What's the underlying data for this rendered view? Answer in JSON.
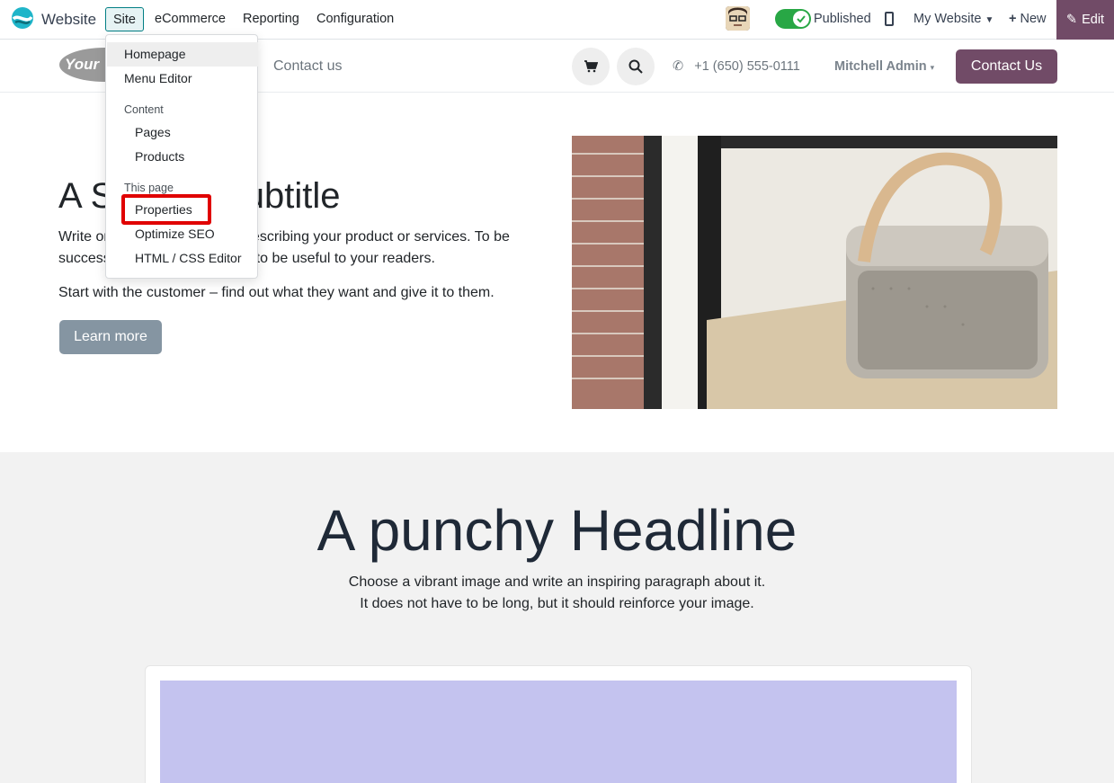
{
  "topbar": {
    "app_name": "Website",
    "menu": [
      "Site",
      "eCommerce",
      "Reporting",
      "Configuration"
    ],
    "published_label": "Published",
    "my_website": "My Website",
    "new_label": "New",
    "edit_label": "Edit"
  },
  "site_header": {
    "logo_text": "Your",
    "nav_contact": "Contact us",
    "phone": "+1 (650) 555-0111",
    "user": "Mitchell Admin",
    "contact_button": "Contact Us"
  },
  "hero": {
    "title": "A Section Subtitle",
    "paragraph1": "Write one or two paragraphs describing your product or services. To be successful your content needs to be useful to your readers.",
    "paragraph2": "Start with the customer – find out what they want and give it to them.",
    "button": "Learn more"
  },
  "section2": {
    "headline": "A punchy Headline",
    "line1": "Choose a vibrant image and write an inspiring paragraph about it.",
    "line2": "It does not have to be long, but it should reinforce your image."
  },
  "dropdown": {
    "homepage": "Homepage",
    "menu_editor": "Menu Editor",
    "content_header": "Content",
    "pages": "Pages",
    "products": "Products",
    "this_page_header": "This page",
    "properties": "Properties",
    "optimize_seo": "Optimize SEO",
    "html_css_editor": "HTML / CSS Editor"
  },
  "colors": {
    "brand": "#714b67",
    "toggle_on": "#28a745",
    "highlight_box": "#e00000"
  }
}
